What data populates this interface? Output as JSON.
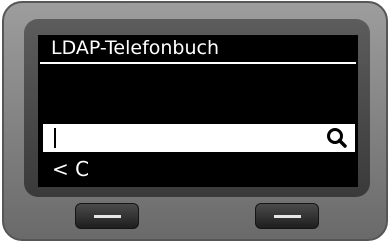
{
  "screen": {
    "title": "LDAP-Telefonbuch",
    "search": {
      "value": "",
      "icon": "magnifier-icon"
    },
    "softkeys": {
      "left_label": "< C",
      "right_label": ""
    }
  },
  "hardware": {
    "left_button_icon": "minus-line-icon",
    "right_button_icon": "minus-line-icon"
  },
  "colors": {
    "display_background": "#000000",
    "display_text": "#ffffff",
    "field_background": "#ffffff",
    "device_body": "#7d7d7d"
  }
}
